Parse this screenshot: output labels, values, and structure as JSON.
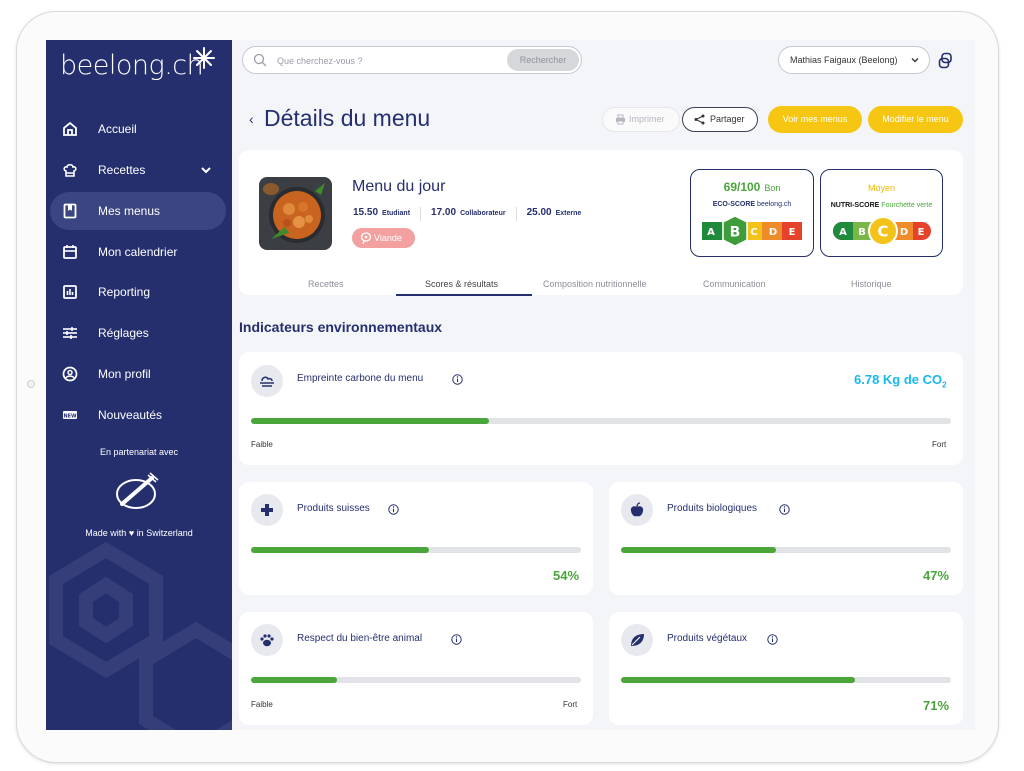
{
  "brand": {
    "logo_text": "beelong.ch"
  },
  "sidebar": {
    "items": [
      {
        "label": "Accueil",
        "icon": "home-icon"
      },
      {
        "label": "Recettes",
        "icon": "chef-hat-icon"
      },
      {
        "label": "Mes menus",
        "icon": "bookmark-icon"
      },
      {
        "label": "Mon calendrier",
        "icon": "calendar-icon"
      },
      {
        "label": "Reporting",
        "icon": "chart-icon"
      },
      {
        "label": "Réglages",
        "icon": "sliders-icon"
      },
      {
        "label": "Mon profil",
        "icon": "profile-icon"
      },
      {
        "label": "Nouveautés",
        "icon": "new-badge-icon"
      }
    ],
    "partner_text": "En partenariat avec",
    "partner_logo_text": "Fourchette verte",
    "made_with_prefix": "Made with",
    "made_with_suffix": "in Switzerland"
  },
  "topbar": {
    "search_placeholder": "Que cherchez-vous ?",
    "search_button": "Rechercher",
    "user_name": "Mathias Faigaux (Beelong)"
  },
  "header": {
    "back": "‹",
    "title": "Détails du menu",
    "print": "Imprimer",
    "share": "Partager",
    "view_menus": "Voir mes menus",
    "edit_menu": "Modifier le menu"
  },
  "menu": {
    "name": "Menu du jour",
    "prices": [
      {
        "value": "15.50",
        "label": "Etudiant"
      },
      {
        "value": "17.00",
        "label": "Collaborateur"
      },
      {
        "value": "25.00",
        "label": "Externe"
      }
    ],
    "tag": "Viande"
  },
  "eco_score": {
    "score": "69/100",
    "qualifier": "Bon",
    "label_main": "ECO-SCORE",
    "label_brand": "beelong.ch",
    "grades": [
      "A",
      "B",
      "C",
      "D",
      "E"
    ],
    "selected": "B"
  },
  "nutri_score": {
    "qualifier": "Moyen",
    "label_main": "NUTRI-SCORE",
    "label_brand": "Fourchette verte",
    "grades": [
      "A",
      "B",
      "C",
      "D",
      "E"
    ],
    "selected": "C"
  },
  "tabs": [
    "Recettes",
    "Scores & résultats",
    "Composition nutritionnelle",
    "Communication",
    "Historique"
  ],
  "active_tab": "Scores & résultats",
  "section_title": "Indicateurs environnementaux",
  "indicators": {
    "carbon": {
      "label": "Empreinte carbone du menu",
      "value_prefix": "6.78 Kg de CO",
      "value_sub": "2",
      "level": 0.34,
      "low": "Faible",
      "high": "Fort",
      "icon": "cloud-layers-icon"
    },
    "swiss": {
      "label": "Produits suisses",
      "percent": 54,
      "percent_text": "54%",
      "icon": "swiss-cross-icon"
    },
    "bio": {
      "label": "Produits biologiques",
      "percent": 47,
      "percent_text": "47%",
      "icon": "apple-icon"
    },
    "animal": {
      "label": "Respect du bien-être animal",
      "level": 0.26,
      "low": "Faible",
      "high": "Fort",
      "icon": "paw-icon"
    },
    "vegetal": {
      "label": "Produits végétaux",
      "percent": 71,
      "percent_text": "71%",
      "icon": "leaf-icon"
    }
  },
  "colors": {
    "primary": "#252f6e",
    "accent_yellow": "#f6c612",
    "good_green": "#4aa63b",
    "co2_blue": "#19b8ef",
    "tag_red": "#f2a0a0"
  }
}
